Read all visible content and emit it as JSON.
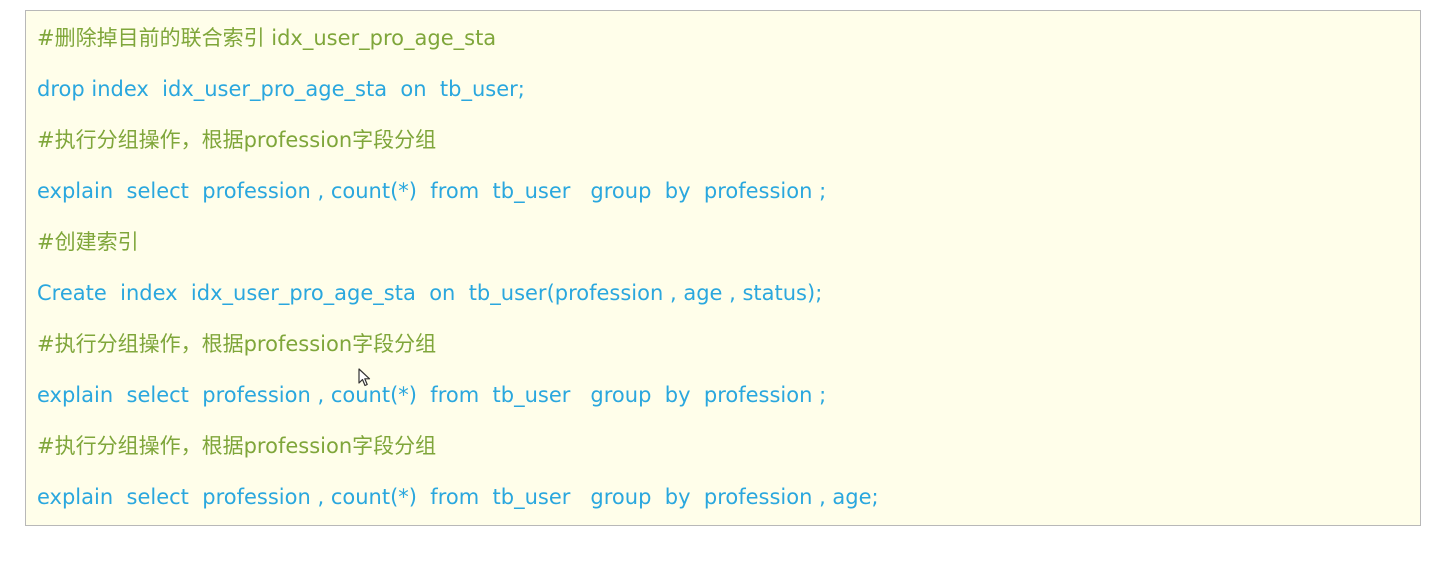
{
  "colors": {
    "background": "#fffeea",
    "border": "#b8b8b8",
    "comment": "#7fa63a",
    "code": "#2aa7de"
  },
  "cursor_icon": "mouse-pointer-arrow",
  "lines": [
    {
      "type": "comment",
      "text": "#删除掉目前的联合索引 idx_user_pro_age_sta"
    },
    {
      "type": "code",
      "text": "drop index  idx_user_pro_age_sta  on  tb_user;"
    },
    {
      "type": "comment",
      "text": "#执行分组操作，根据profession字段分组"
    },
    {
      "type": "code",
      "text": "explain  select  profession , count(*)  from  tb_user   group  by  profession ;"
    },
    {
      "type": "comment",
      "text": "#创建索引"
    },
    {
      "type": "code",
      "text": "Create  index  idx_user_pro_age_sta  on  tb_user(profession , age , status);"
    },
    {
      "type": "comment",
      "text": "#执行分组操作，根据profession字段分组"
    },
    {
      "type": "code",
      "text": "explain  select  profession , count(*)  from  tb_user   group  by  profession ;"
    },
    {
      "type": "comment",
      "text": "#执行分组操作，根据profession字段分组"
    },
    {
      "type": "code",
      "text": "explain  select  profession , count(*)  from  tb_user   group  by  profession , age;"
    }
  ]
}
